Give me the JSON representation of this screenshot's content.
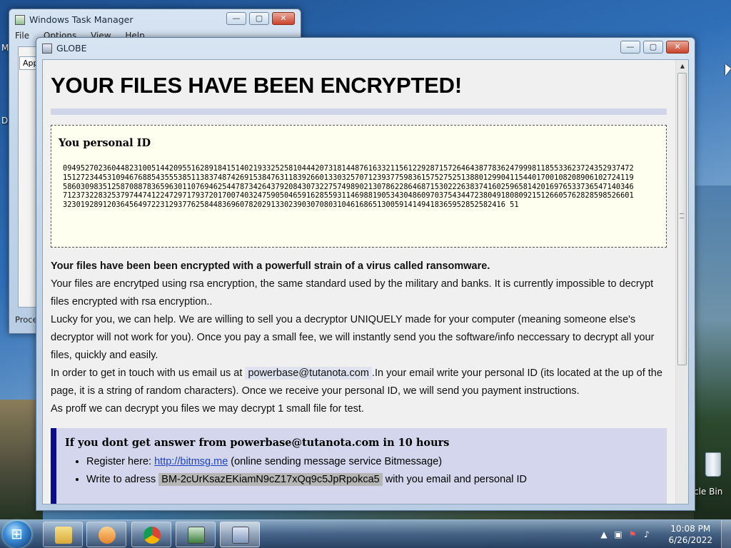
{
  "desktop": {
    "left_labels": [
      "M",
      "D"
    ],
    "recycle_bin_label": "cle Bin"
  },
  "taskmgr": {
    "title": "Windows Task Manager",
    "menu": [
      "File",
      "Options",
      "View",
      "Help"
    ],
    "tab_label": "App",
    "processes_label": "Proce",
    "buttons": {
      "minimize": "—",
      "maximize": "▢",
      "close": "✕"
    }
  },
  "globe": {
    "title": "GLOBE",
    "buttons": {
      "minimize": "—",
      "maximize": "▢",
      "close": "✕"
    },
    "headline": "YOUR FILES HAVE BEEN ENCRYPTED!",
    "id_label": "You personal ID",
    "id_code": "0949527023604482310051442095516289184151402193325258104442073181448761633211561229287157264643877836247999811855336237243529374721512723445310946768854355538511383748742691538476311839266013303257071239377598361575275251388012990411544017001082089061027241195860309835125870887836596301107694625447873426437920843073227574989021307862286468715302226383741602596581420169765337365471403467123732283253797447412247297179372017007403247590504659162855931146988190534304860970375434472380491808092151266057628285985266013230192891203645649722312937762584483696078202913302390307080310461686513005914149418365952852582416 51",
    "lead": "Your files have been been encrypted with a powerfull strain of a virus called ransomware.",
    "para1": "Your files are encrytped using rsa encryption, the same standard used by the military and banks. It is currently impossible to decrypt files encrypted with rsa encryption..",
    "para2": "Lucky for you, we can help. We are willing to sell you a decryptor UNIQUELY made for your computer (meaning someone else's decryptor will not work for you). Once you pay a small fee, we will instantly send you the software/info neccessary to decrypt all your files, quickly and easily.",
    "contact_pre": "In order to get in touch with us email us at",
    "contact_email": "powerbase@tutanota.com",
    "contact_post": ".In your email write your personal ID (its located at the up of the page, it is a string of random characters). Once we receive your personal ID, we will send you payment instructions.",
    "para_proof": "As proff we can decrypt you files we may decrypt 1 small file for test.",
    "notice_title": "If you dont get answer from powerbase@tutanota.com in 10 hours",
    "bullet1_pre": "Register here:",
    "bullet1_link": "http://bitmsg.me",
    "bullet1_post": "(online sending message service Bitmessage)",
    "bullet2_pre": "Write to adress",
    "bullet2_addr": "BM-2cUrKsazEKiamN9cZ17xQq9c5JpRpokca5",
    "bullet2_post": "with you email and personal ID"
  },
  "taskbar": {
    "time": "10:08 PM",
    "date": "6/26/2022"
  }
}
